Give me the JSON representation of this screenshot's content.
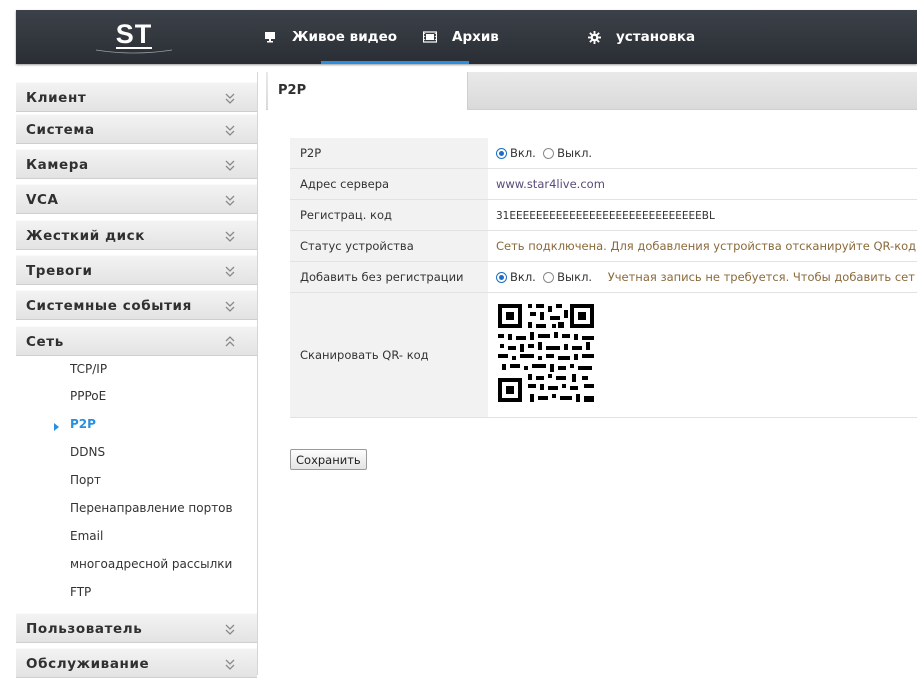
{
  "logo": {
    "text": "ST"
  },
  "nav": {
    "items": [
      {
        "label": "Живое видео",
        "icon": "monitor-icon"
      },
      {
        "label": "Архив",
        "icon": "film-icon"
      },
      {
        "label": "установка",
        "icon": "gear-icon",
        "active": true
      }
    ],
    "accent_color": "#2a8fe0"
  },
  "sidebar": {
    "groups": [
      {
        "label": "Клиент",
        "state": "collapsed"
      },
      {
        "label": "Система",
        "state": "collapsed"
      },
      {
        "label": "Камера",
        "state": "collapsed"
      },
      {
        "label": "VCA",
        "state": "collapsed"
      },
      {
        "label": "Жесткий диск",
        "state": "collapsed"
      },
      {
        "label": "Тревоги",
        "state": "collapsed"
      },
      {
        "label": "Системные события",
        "state": "collapsed"
      },
      {
        "label": "Сеть",
        "state": "expanded"
      },
      {
        "label": "Пользователь",
        "state": "collapsed"
      },
      {
        "label": "Обслуживание",
        "state": "collapsed"
      }
    ],
    "network_items": [
      {
        "label": "TCP/IP"
      },
      {
        "label": "PPPoE"
      },
      {
        "label": "P2P",
        "active": true
      },
      {
        "label": "DDNS"
      },
      {
        "label": "Порт"
      },
      {
        "label": "Перенаправление портов"
      },
      {
        "label": "Email"
      },
      {
        "label": "многоадресной рассылки"
      },
      {
        "label": "FTP"
      }
    ]
  },
  "main": {
    "tab": "P2P",
    "rows": {
      "p2p": {
        "label": "P2P",
        "on": "Вкл.",
        "off": "Выкл.",
        "selected": "on"
      },
      "server": {
        "label": "Адрес сервера",
        "value": "www.star4live.com"
      },
      "regcode": {
        "label": "Регистрац. код",
        "value": "31ЕЕЕЕЕЕЕЕЕЕЕЕЕЕЕЕЕЕЕЕЕЕЕЕЕЕЕЕЕBL"
      },
      "status": {
        "label": "Статус устройства",
        "value": "Сеть подключена. Для добавления устройства отсканируйте QR-код"
      },
      "noreg": {
        "label": "Добавить без регистрации",
        "on": "Вкл.",
        "off": "Выкл.",
        "selected": "on",
        "note": "Учетная запись не требуется. Чтобы добавить сет"
      },
      "qr": {
        "label": "Сканировать QR- код"
      }
    },
    "save_label": "Сохранить"
  }
}
